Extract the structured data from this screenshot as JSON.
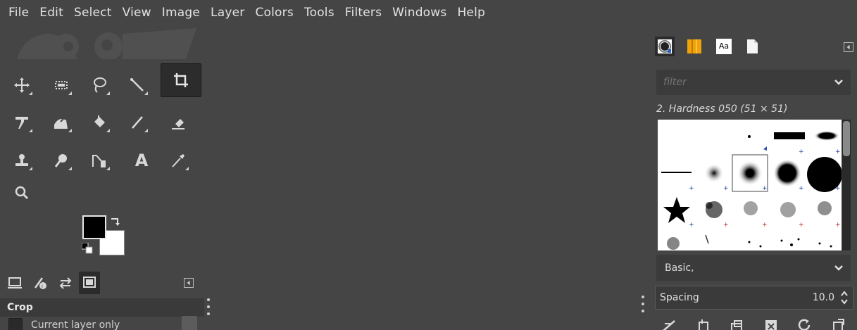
{
  "menubar": {
    "items": [
      "File",
      "Edit",
      "Select",
      "View",
      "Image",
      "Layer",
      "Colors",
      "Tools",
      "Filters",
      "Windows",
      "Help"
    ]
  },
  "toolbox": {
    "tools": [
      {
        "name": "move-tool-icon",
        "active": false
      },
      {
        "name": "rect-select-tool-icon",
        "active": false
      },
      {
        "name": "free-select-tool-icon",
        "active": false
      },
      {
        "name": "fuzzy-select-tool-icon",
        "active": false
      },
      {
        "name": "crop-tool-icon",
        "active": true
      },
      {
        "name": "unified-transform-tool-icon",
        "active": false
      },
      {
        "name": "warp-transform-tool-icon",
        "active": false
      },
      {
        "name": "bucket-fill-tool-icon",
        "active": false
      },
      {
        "name": "paintbrush-tool-icon",
        "active": false
      },
      {
        "name": "eraser-tool-icon",
        "active": false
      },
      {
        "name": "clone-tool-icon",
        "active": false
      },
      {
        "name": "smudge-tool-icon",
        "active": false
      },
      {
        "name": "paths-tool-icon",
        "active": false
      },
      {
        "name": "text-tool-icon",
        "active": false
      },
      {
        "name": "color-picker-tool-icon",
        "active": false
      },
      {
        "name": "zoom-tool-icon",
        "active": false
      }
    ],
    "text_tool_glyph": "A",
    "fg_color": "#000000",
    "bg_color": "#ffffff"
  },
  "tool_options": {
    "title": "Crop",
    "options": [
      {
        "label": "Current layer only",
        "checked": false
      }
    ]
  },
  "brushes_panel": {
    "filter_placeholder": "filter",
    "selected_brush": "2. Hardness 050 (51 × 51)",
    "tags_value": "Basic,",
    "spacing_label": "Spacing",
    "spacing_value": "10.0",
    "tab_fonts_glyph": "Aa"
  },
  "colors": {
    "bg": "#454545",
    "accent": "#f0a30a",
    "dark": "#2b2b2b"
  }
}
